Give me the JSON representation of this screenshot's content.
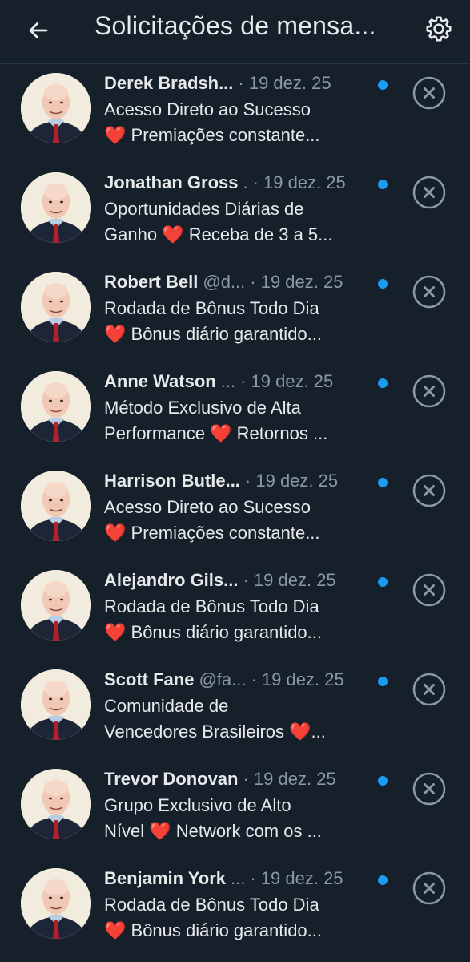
{
  "header": {
    "title": "Solicitações de mensa...",
    "back_icon": "arrow-left-icon",
    "settings_icon": "gear-icon"
  },
  "colors": {
    "background": "#15202b",
    "text": "#e7e9ea",
    "muted": "#8b98a5",
    "unread_dot": "#1d9bf0",
    "heart": "#e0245e"
  },
  "requests": [
    {
      "name": "Derek Bradsh...",
      "handle": "",
      "date": "· 19 dez. 25",
      "line1": "Acesso Direto ao Sucesso",
      "line2_before": "",
      "heart": "❤️",
      "line2_after": " Premiações constante..."
    },
    {
      "name": "Jonathan Gross",
      "handle": ".",
      "date": "· 19 dez. 25",
      "line1": "Oportunidades Diárias de",
      "line2_before": "Ganho ",
      "heart": "❤️",
      "line2_after": " Receba de 3 a 5..."
    },
    {
      "name": "Robert Bell",
      "handle": "@d...",
      "date": "· 19 dez. 25",
      "line1": "Rodada de Bônus Todo Dia",
      "line2_before": "",
      "heart": "❤️",
      "line2_after": " Bônus diário garantido..."
    },
    {
      "name": "Anne Watson",
      "handle": "...",
      "date": "· 19 dez. 25",
      "line1": "Método Exclusivo de Alta",
      "line2_before": "Performance ",
      "heart": "❤️",
      "line2_after": " Retornos ..."
    },
    {
      "name": "Harrison Butle...",
      "handle": "",
      "date": "· 19 dez. 25",
      "line1": "Acesso Direto ao Sucesso",
      "line2_before": "",
      "heart": "❤️",
      "line2_after": " Premiações constante..."
    },
    {
      "name": "Alejandro Gils...",
      "handle": "",
      "date": "· 19 dez. 25",
      "line1": "Rodada de Bônus Todo Dia",
      "line2_before": "",
      "heart": "❤️",
      "line2_after": " Bônus diário garantido..."
    },
    {
      "name": "Scott Fane",
      "handle": "@fa...",
      "date": "· 19 dez. 25",
      "line1": "Comunidade de",
      "line2_before": "Vencedores Brasileiros ",
      "heart": "❤️",
      "line2_after": "..."
    },
    {
      "name": "Trevor Donovan",
      "handle": "",
      "date": "· 19 dez. 25",
      "line1": "Grupo Exclusivo de Alto",
      "line2_before": "Nível ",
      "heart": "❤️",
      "line2_after": " Network com os ..."
    },
    {
      "name": "Benjamin York",
      "handle": "...",
      "date": "· 19 dez. 25",
      "line1": "Rodada de Bônus Todo Dia",
      "line2_before": "",
      "heart": "❤️",
      "line2_after": " Bônus diário garantido..."
    }
  ]
}
